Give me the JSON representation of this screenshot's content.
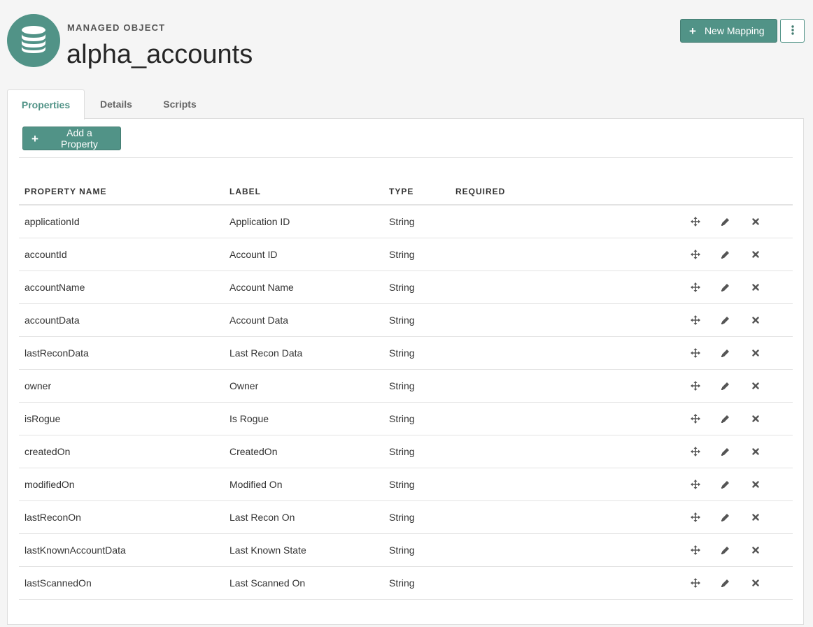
{
  "header": {
    "eyebrow": "MANAGED OBJECT",
    "title": "alpha_accounts",
    "icon": "database-icon",
    "new_mapping_label": "New Mapping"
  },
  "tabs": [
    {
      "label": "Properties",
      "active": true
    },
    {
      "label": "Details",
      "active": false
    },
    {
      "label": "Scripts",
      "active": false
    }
  ],
  "toolbar": {
    "add_property_label": "Add a Property"
  },
  "table": {
    "columns": [
      "PROPERTY NAME",
      "LABEL",
      "TYPE",
      "REQUIRED"
    ],
    "rows": [
      {
        "name": "applicationId",
        "label": "Application ID",
        "type": "String",
        "required": ""
      },
      {
        "name": "accountId",
        "label": "Account ID",
        "type": "String",
        "required": ""
      },
      {
        "name": "accountName",
        "label": "Account Name",
        "type": "String",
        "required": ""
      },
      {
        "name": "accountData",
        "label": "Account Data",
        "type": "String",
        "required": ""
      },
      {
        "name": "lastReconData",
        "label": "Last Recon Data",
        "type": "String",
        "required": ""
      },
      {
        "name": "owner",
        "label": "Owner",
        "type": "String",
        "required": ""
      },
      {
        "name": "isRogue",
        "label": "Is Rogue",
        "type": "String",
        "required": ""
      },
      {
        "name": "createdOn",
        "label": "CreatedOn",
        "type": "String",
        "required": ""
      },
      {
        "name": "modifiedOn",
        "label": "Modified On",
        "type": "String",
        "required": ""
      },
      {
        "name": "lastReconOn",
        "label": "Last Recon On",
        "type": "String",
        "required": ""
      },
      {
        "name": "lastKnownAccountData",
        "label": "Last Known State",
        "type": "String",
        "required": ""
      },
      {
        "name": "lastScannedOn",
        "label": "Last Scanned On",
        "type": "String",
        "required": ""
      }
    ],
    "row_actions": [
      "move-icon",
      "pencil-icon",
      "close-icon"
    ]
  },
  "colors": {
    "accent": "#519387",
    "background": "#f5f5f5",
    "panel": "#ffffff",
    "border": "#dddddd"
  }
}
